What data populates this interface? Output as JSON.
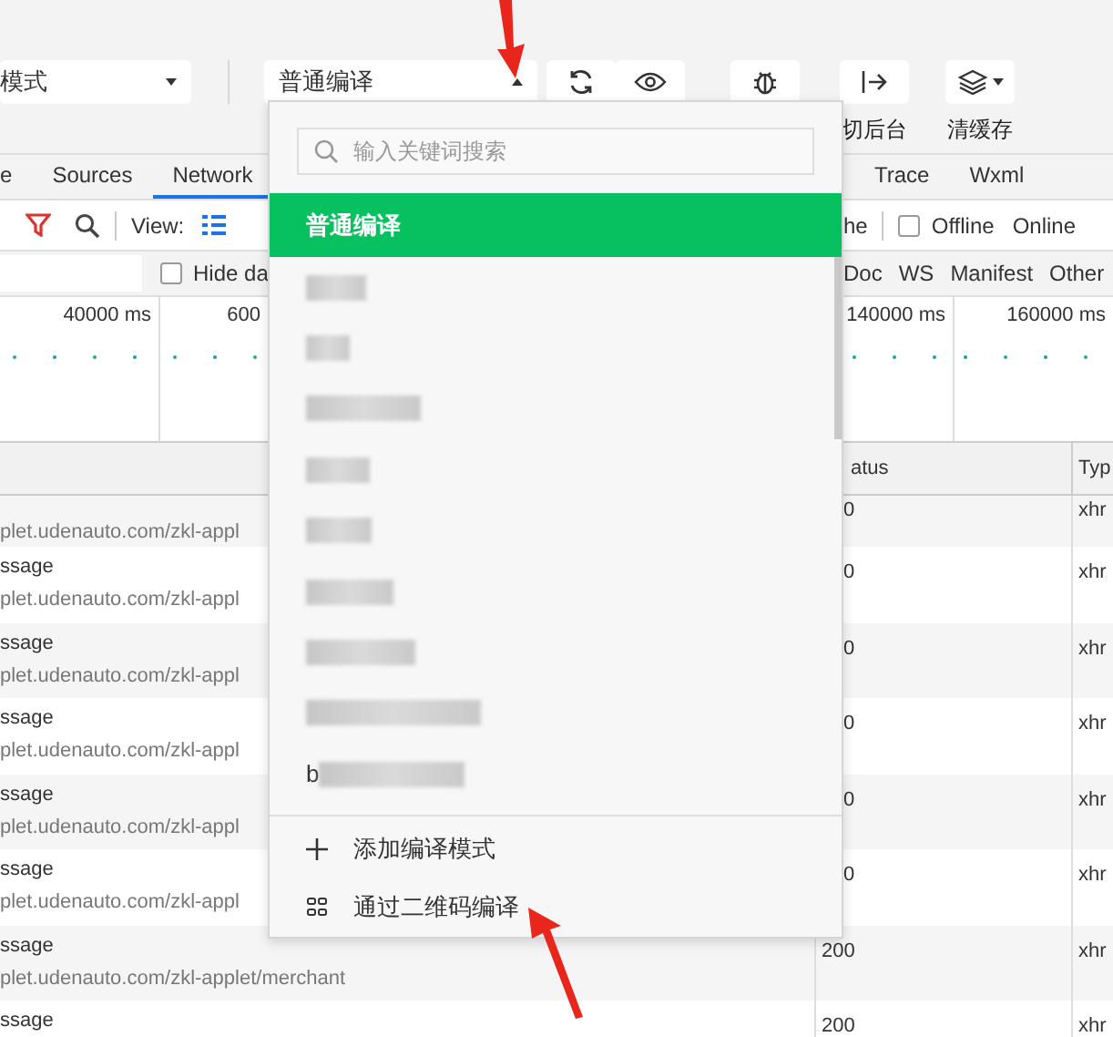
{
  "toolbar": {
    "mode_select": "模式",
    "compile_select": {
      "label": "普通编译",
      "expanded": true
    },
    "buttons": [
      {
        "kind": "refresh"
      },
      {
        "kind": "preview"
      },
      {
        "kind": "debug"
      },
      {
        "kind": "background",
        "label": "切后台"
      },
      {
        "kind": "cache",
        "label": "清缓存"
      }
    ]
  },
  "tabs": {
    "left": [
      {
        "label": "e",
        "selected": false
      },
      {
        "label": "Sources",
        "selected": false
      },
      {
        "label": "Network",
        "selected": true
      }
    ],
    "right": [
      {
        "label": "Trace",
        "selected": false
      },
      {
        "label": "Wxml",
        "selected": false
      }
    ]
  },
  "network_toolbar": {
    "view_label": "View:",
    "cache_label": "he",
    "offline": {
      "label": "Offline",
      "checked": false
    },
    "throttle": "Online"
  },
  "filter_bar": {
    "hide_data": {
      "label": "Hide da",
      "checked": false
    },
    "types": [
      "Doc",
      "WS",
      "Manifest",
      "Other"
    ]
  },
  "timeline": {
    "left_ticks": [
      "40000 ms",
      "600"
    ],
    "right_ticks": [
      "140000 ms",
      "160000 ms"
    ]
  },
  "table": {
    "columns": [
      "atus",
      "Typ"
    ],
    "rows": [
      {
        "kind": "covered",
        "url": "plet.udenauto.com/zkl-appl",
        "status": "0",
        "type": "xhr"
      },
      {
        "kind": "covered",
        "name": "ssage",
        "url": "plet.udenauto.com/zkl-appl",
        "status": "0",
        "type": "xhr"
      },
      {
        "kind": "covered",
        "name": "ssage",
        "url": "plet.udenauto.com/zkl-appl",
        "status": "0",
        "type": "xhr"
      },
      {
        "kind": "covered",
        "name": "ssage",
        "url": "plet.udenauto.com/zkl-appl",
        "status": "0",
        "type": "xhr"
      },
      {
        "kind": "covered",
        "name": "ssage",
        "url": "plet.udenauto.com/zkl-appl",
        "status": "0",
        "type": "xhr"
      },
      {
        "kind": "covered",
        "name": "ssage",
        "url": "plet.udenauto.com/zkl-appl",
        "status": "0",
        "type": "xhr"
      },
      {
        "kind": "full",
        "name": "ssage",
        "url": "plet.udenauto.com/zkl-applet/merchant",
        "status": "200",
        "type": "xhr"
      },
      {
        "kind": "full",
        "name": "ssage",
        "status": "200",
        "type": "xhr"
      }
    ]
  },
  "compile_menu": {
    "search_placeholder": "输入关键词搜索",
    "modes": [
      {
        "kind": "text",
        "label": "普通编译",
        "selected": true
      },
      {
        "kind": "redacted",
        "selected": false
      },
      {
        "kind": "redacted",
        "selected": false
      },
      {
        "kind": "redacted",
        "selected": false
      },
      {
        "kind": "redacted",
        "selected": false
      },
      {
        "kind": "redacted",
        "selected": false
      },
      {
        "kind": "redacted",
        "selected": false
      },
      {
        "kind": "redacted",
        "selected": false
      },
      {
        "kind": "redacted",
        "selected": false
      },
      {
        "kind": "redacted",
        "label": "b",
        "selected": false
      }
    ],
    "actions": [
      {
        "kind": "add",
        "label": "添加编译模式"
      },
      {
        "kind": "qrcode",
        "label": "通过二维码编译"
      }
    ]
  }
}
